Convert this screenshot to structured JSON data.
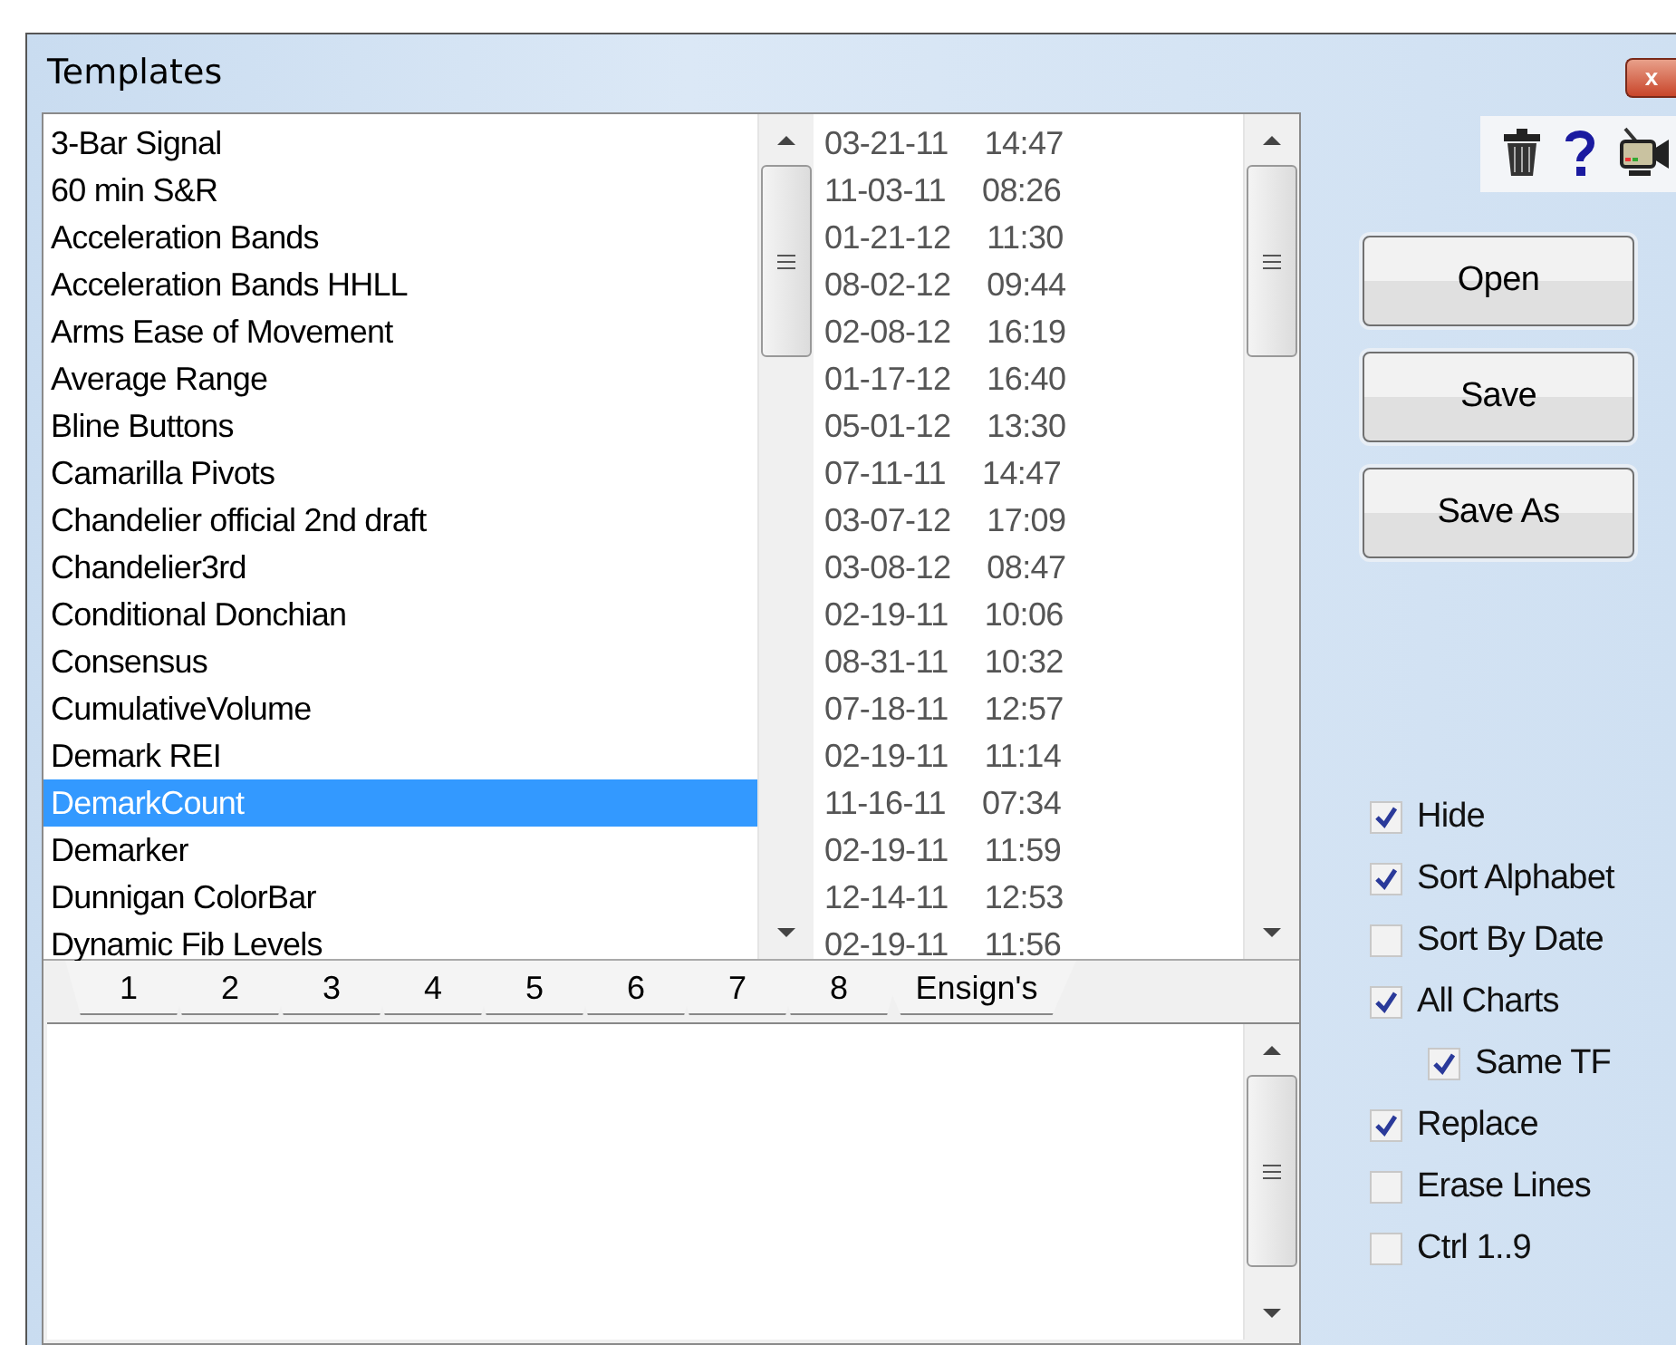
{
  "window": {
    "title": "Templates",
    "close": "x"
  },
  "templates": [
    {
      "name": "3-Bar Signal",
      "date": "03-21-11",
      "time": "14:47",
      "selected": false
    },
    {
      "name": "60 min S&R",
      "date": "11-03-11",
      "time": "08:26",
      "selected": false
    },
    {
      "name": "Acceleration Bands",
      "date": "01-21-12",
      "time": "11:30",
      "selected": false
    },
    {
      "name": "Acceleration Bands HHLL",
      "date": "08-02-12",
      "time": "09:44",
      "selected": false
    },
    {
      "name": "Arms Ease of Movement",
      "date": "02-08-12",
      "time": "16:19",
      "selected": false
    },
    {
      "name": "Average Range",
      "date": "01-17-12",
      "time": "16:40",
      "selected": false
    },
    {
      "name": "Bline Buttons",
      "date": "05-01-12",
      "time": "13:30",
      "selected": false
    },
    {
      "name": "Camarilla Pivots",
      "date": "07-11-11",
      "time": "14:47",
      "selected": false
    },
    {
      "name": "Chandelier official 2nd draft",
      "date": "03-07-12",
      "time": "17:09",
      "selected": false
    },
    {
      "name": "Chandelier3rd",
      "date": "03-08-12",
      "time": "08:47",
      "selected": false
    },
    {
      "name": "Conditional Donchian",
      "date": "02-19-11",
      "time": "10:06",
      "selected": false
    },
    {
      "name": "Consensus",
      "date": "08-31-11",
      "time": "10:32",
      "selected": false
    },
    {
      "name": "CumulativeVolume",
      "date": "07-18-11",
      "time": "12:57",
      "selected": false
    },
    {
      "name": "Demark REI",
      "date": "02-19-11",
      "time": "11:14",
      "selected": false
    },
    {
      "name": "DemarkCount",
      "date": "11-16-11",
      "time": "07:34",
      "selected": true
    },
    {
      "name": "Demarker",
      "date": "02-19-11",
      "time": "11:59",
      "selected": false
    },
    {
      "name": "Dunnigan ColorBar",
      "date": "12-14-11",
      "time": "12:53",
      "selected": false
    },
    {
      "name": "Dynamic Fib Levels",
      "date": "02-19-11",
      "time": "11:56",
      "selected": false
    }
  ],
  "tabs": [
    {
      "label": "1"
    },
    {
      "label": "2"
    },
    {
      "label": "3"
    },
    {
      "label": "4"
    },
    {
      "label": "5"
    },
    {
      "label": "6"
    },
    {
      "label": "7"
    },
    {
      "label": "8"
    },
    {
      "label": "Ensign's"
    }
  ],
  "buttons": [
    "Open",
    "Save",
    "Save As"
  ],
  "options": [
    {
      "label": "Hide",
      "checked": true,
      "indented": false
    },
    {
      "label": "Sort Alphabet",
      "checked": true,
      "indented": false
    },
    {
      "label": "Sort By Date",
      "checked": false,
      "indented": false
    },
    {
      "label": "All Charts",
      "checked": true,
      "indented": false
    },
    {
      "label": "Same TF",
      "checked": true,
      "indented": true
    },
    {
      "label": "Replace",
      "checked": true,
      "indented": false
    },
    {
      "label": "Erase Lines",
      "checked": false,
      "indented": false
    },
    {
      "label": "Ctrl 1..9",
      "checked": false,
      "indented": false
    }
  ]
}
